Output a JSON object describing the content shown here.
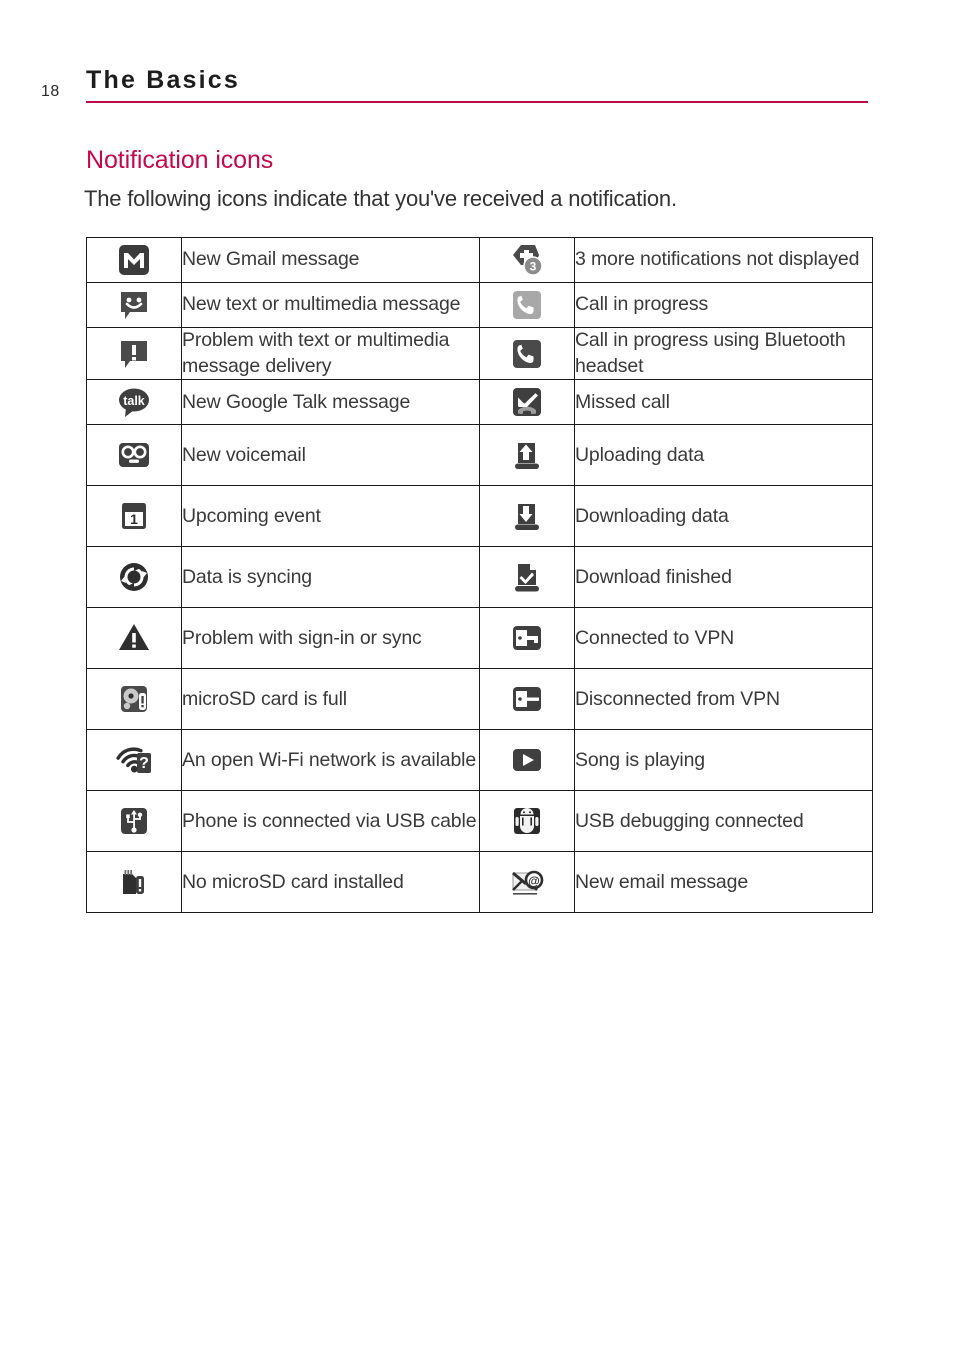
{
  "page": {
    "number": "18",
    "chapter_title": "The Basics",
    "rule_color": "#bd0b45"
  },
  "section": {
    "heading": "Notification icons",
    "heading_color": "#c4084b",
    "intro": "The following icons indicate that you've received a notification."
  },
  "table": {
    "rows": [
      {
        "left": {
          "icon": "gmail-icon",
          "label": "New Gmail message"
        },
        "right": {
          "icon": "more-notifications-icon",
          "label": "3 more notifications not displayed",
          "badge": "3"
        }
      },
      {
        "left": {
          "icon": "sms-message-icon",
          "label": "New text or multimedia message"
        },
        "right": {
          "icon": "call-in-progress-icon",
          "label": "Call in progress"
        }
      },
      {
        "left": {
          "icon": "message-problem-icon",
          "label": "Problem with text or multimedia message delivery"
        },
        "right": {
          "icon": "call-bluetooth-icon",
          "label": "Call in progress using Bluetooth headset"
        }
      },
      {
        "left": {
          "icon": "google-talk-icon",
          "label": "New Google Talk message",
          "glyph_text": "talk"
        },
        "right": {
          "icon": "missed-call-icon",
          "label": "Missed call"
        }
      },
      {
        "left": {
          "icon": "voicemail-icon",
          "label": "New voicemail"
        },
        "right": {
          "icon": "upload-data-icon",
          "label": "Uploading data"
        }
      },
      {
        "left": {
          "icon": "calendar-event-icon",
          "label": "Upcoming event",
          "glyph_text": "1"
        },
        "right": {
          "icon": "download-data-icon",
          "label": "Downloading data"
        }
      },
      {
        "left": {
          "icon": "sync-icon",
          "label": "Data is syncing"
        },
        "right": {
          "icon": "download-finished-icon",
          "label": "Download finished"
        }
      },
      {
        "left": {
          "icon": "warning-triangle-icon",
          "label": "Problem with sign-in or sync"
        },
        "right": {
          "icon": "vpn-connected-icon",
          "label": "Connected to VPN"
        }
      },
      {
        "left": {
          "icon": "sdcard-full-icon",
          "label": "microSD card is full"
        },
        "right": {
          "icon": "vpn-disconnected-icon",
          "label": "Disconnected from VPN"
        }
      },
      {
        "left": {
          "icon": "wifi-open-network-icon",
          "label": "An open Wi-Fi network is available"
        },
        "right": {
          "icon": "music-play-icon",
          "label": "Song is playing"
        }
      },
      {
        "left": {
          "icon": "usb-cable-icon",
          "label": "Phone is connected via USB cable"
        },
        "right": {
          "icon": "usb-debugging-icon",
          "label": "USB debugging connected"
        }
      },
      {
        "left": {
          "icon": "no-sdcard-icon",
          "label": "No microSD card installed"
        },
        "right": {
          "icon": "new-email-icon",
          "label": "New email message"
        }
      }
    ]
  }
}
